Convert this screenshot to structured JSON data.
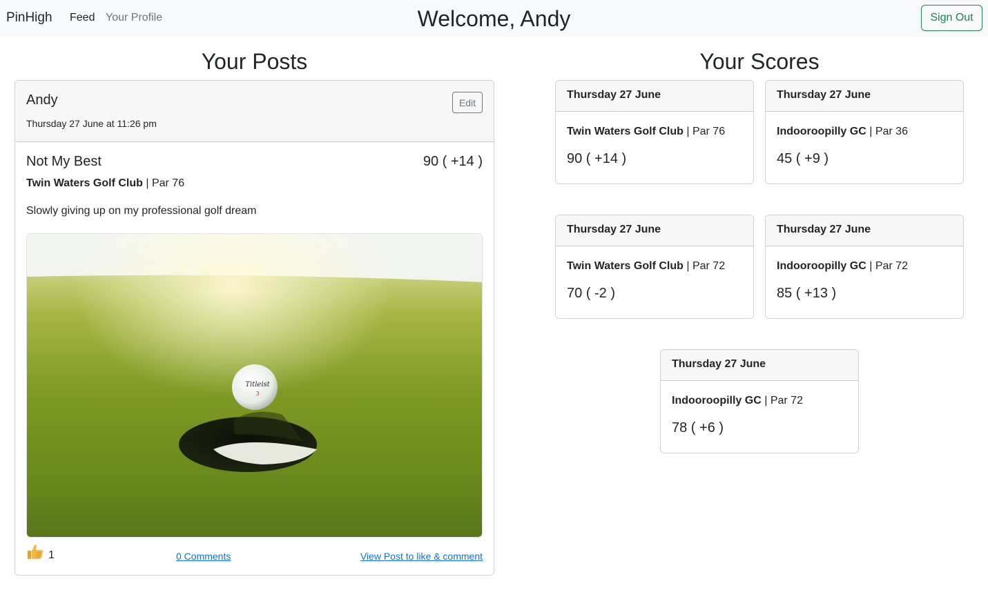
{
  "navbar": {
    "brand": "PinHigh",
    "links": [
      "Feed",
      "Your Profile"
    ],
    "welcome": "Welcome, Andy",
    "sign_out": "Sign Out"
  },
  "posts_section": {
    "title": "Your Posts",
    "post": {
      "author": "Andy",
      "date": "Thursday 27 June at 11:26 pm",
      "edit_label": "Edit",
      "title": "Not My Best",
      "score": "90 ( +14 )",
      "course": "Twin Waters Golf Club",
      "par": "| Par 76",
      "body": "Slowly giving up on my professional golf dream",
      "like_icon": "thumbs-up-icon",
      "likes": "1",
      "comments_link": "0 Comments",
      "view_link": "View Post to like & comment"
    }
  },
  "scores_section": {
    "title": "Your Scores",
    "scores": [
      {
        "date": "Thursday 27 June",
        "course": "Twin Waters Golf Club",
        "par": "| Par 76",
        "score": "90 ( +14 )"
      },
      {
        "date": "Thursday 27 June",
        "course": "Indooroopilly GC",
        "par": "| Par 36",
        "score": "45 ( +9 )"
      },
      {
        "date": "Thursday 27 June",
        "course": "Twin Waters Golf Club",
        "par": "| Par 72",
        "score": "70 ( -2 )"
      },
      {
        "date": "Thursday 27 June",
        "course": "Indooroopilly GC",
        "par": "| Par 72",
        "score": "85 ( +13 )"
      },
      {
        "date": "Thursday 27 June",
        "course": "Indooroopilly GC",
        "par": "| Par 72",
        "score": "78 ( +6 )"
      }
    ]
  },
  "colors": {
    "navbar_bg": "#f8f9fa",
    "success": "#198754",
    "link": "#0d6efd",
    "card_header_bg": "#f7f7f7",
    "muted": "#6c757d"
  }
}
